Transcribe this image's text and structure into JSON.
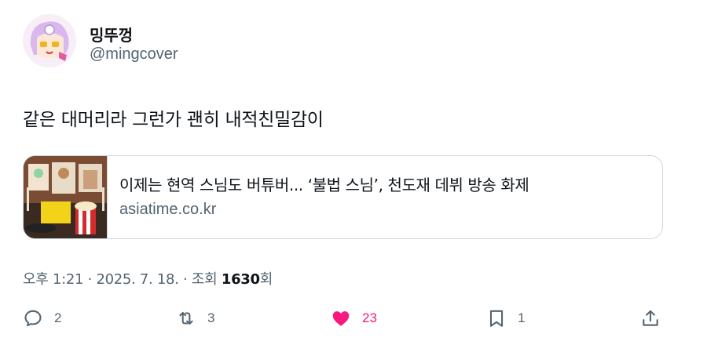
{
  "user": {
    "display_name": "밍뚜껑",
    "handle": "@mingcover"
  },
  "tweet": {
    "text": "같은 대머리라 그런가 괜히 내적친밀감이"
  },
  "link_card": {
    "title": "이제는 현역 스님도 버튜버... ‘불법 스님’, 천도재 데뷔 방송 화제",
    "domain": "asiatime.co.kr"
  },
  "meta": {
    "time": "오후 1:21",
    "sep1": "·",
    "date": "2025. 7. 18.",
    "sep2": "·",
    "views_label": "조회",
    "views_count": "1630",
    "views_suffix": "회"
  },
  "actions": {
    "reply_count": "2",
    "retweet_count": "3",
    "like_count": "23",
    "bookmark_count": "1"
  },
  "colors": {
    "like_accent": "#f91880",
    "secondary_text": "#536471",
    "primary_text": "#0f1419",
    "border": "#cfd9de"
  },
  "icons": [
    "reply-icon",
    "retweet-icon",
    "heart-filled-icon",
    "bookmark-icon",
    "share-icon"
  ]
}
